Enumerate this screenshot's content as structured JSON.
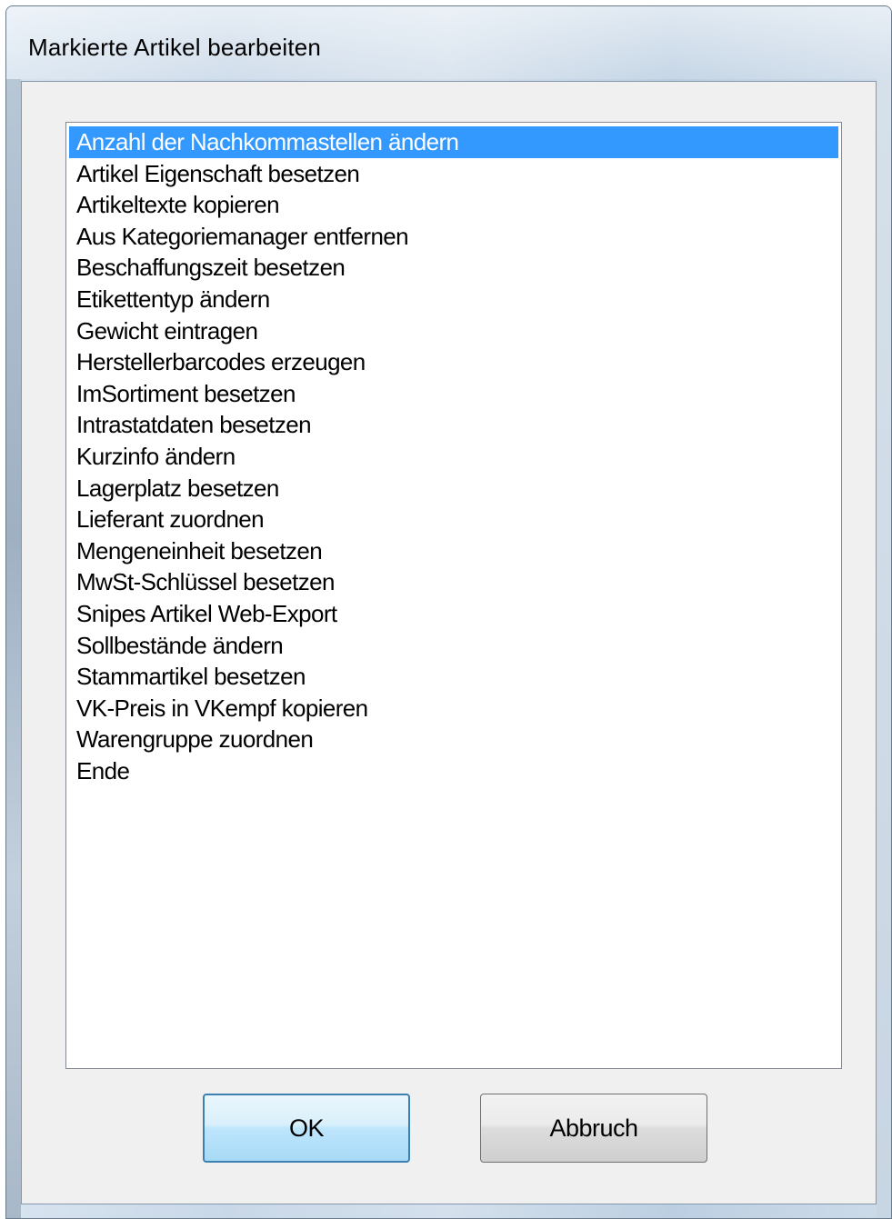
{
  "window": {
    "title": "Markierte Artikel bearbeiten"
  },
  "list": {
    "selected_index": 0,
    "items": [
      "Anzahl der Nachkommastellen ändern",
      "Artikel Eigenschaft besetzen",
      "Artikeltexte kopieren",
      "Aus Kategoriemanager entfernen",
      "Beschaffungszeit besetzen",
      "Etikettentyp ändern",
      "Gewicht eintragen",
      "Herstellerbarcodes erzeugen",
      "ImSortiment besetzen",
      "Intrastatdaten besetzen",
      "Kurzinfo ändern",
      "Lagerplatz besetzen",
      "Lieferant zuordnen",
      "Mengeneinheit besetzen",
      "MwSt-Schlüssel besetzen",
      "Snipes Artikel Web-Export",
      "Sollbestände ändern",
      "Stammartikel besetzen",
      "VK-Preis in VKempf kopieren",
      "Warengruppe zuordnen",
      "Ende"
    ]
  },
  "buttons": {
    "ok_label": "OK",
    "cancel_label": "Abbruch"
  },
  "colors": {
    "selection": "#3399ff",
    "selection_text": "#ffffff",
    "dialog_background": "#f0f0f0"
  }
}
